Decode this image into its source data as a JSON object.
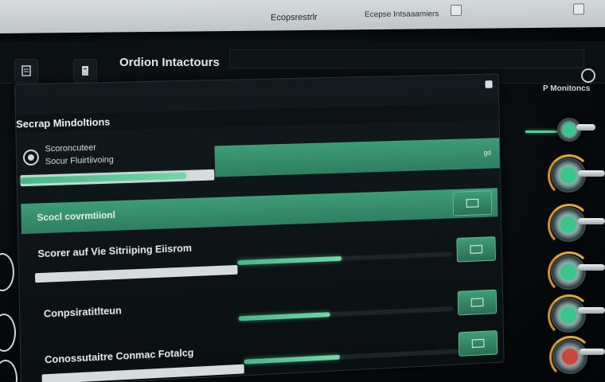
{
  "window": {
    "title": "Ecopsrestrlr",
    "subtitle": "Ecepse Intsaaamiers"
  },
  "toolbar": {
    "app_title": "Ordion Intactours"
  },
  "panel": {
    "header": "Secrap Mindoltions",
    "radio_label_1": "Scoroncuteer",
    "radio_label_2": "Socur Fluirtiivoing",
    "band_label": "Scocl covrmtiionl",
    "row1_label": "Scorer auf Vie Sitriiping Eiisrom",
    "row2_label": "Conpsiratitlteun",
    "row3_label": "Conossutaitre Conmac Fotalcg",
    "corner_tag": "gd"
  },
  "right_column": {
    "header": "P Monitoncs"
  },
  "values": {
    "slider_top": 0.85,
    "slider_row1": 0.48,
    "slider_row2": 0.42,
    "slider_row3": 0.44
  },
  "colors": {
    "accent_green": "#49b789",
    "knob_ring": "#e0a73b",
    "panel_bg": "#0f1517",
    "titlebar": "#cfd4d7"
  },
  "icons": {
    "toolbar_left": "file-icon",
    "toolbar_second": "document-icon",
    "settings": "gear-icon",
    "side_buttons": "screen-icon"
  }
}
